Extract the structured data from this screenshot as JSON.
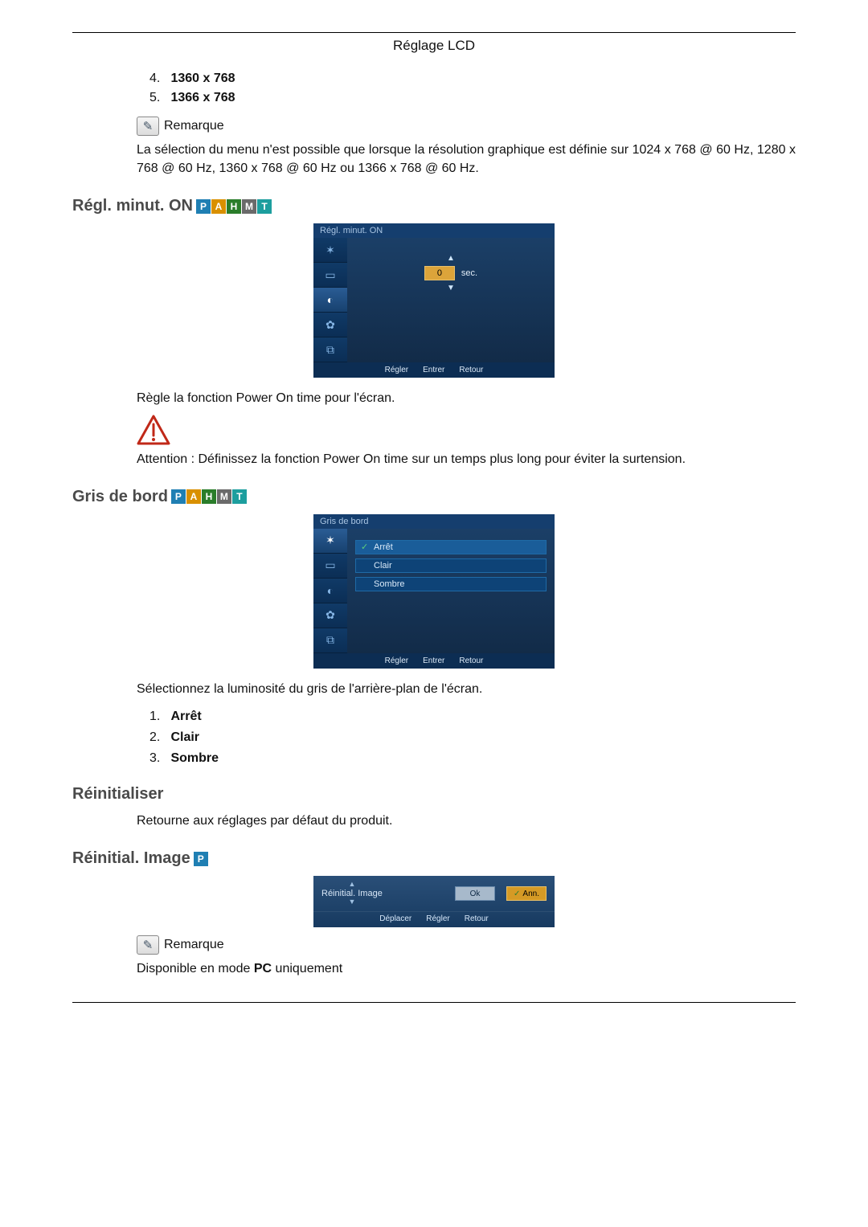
{
  "header": {
    "title": "Réglage LCD"
  },
  "resolutions_cont": [
    {
      "num": "4.",
      "value": "1360 x 768"
    },
    {
      "num": "5.",
      "value": "1366 x 768"
    }
  ],
  "remark": {
    "label": "Remarque",
    "menu_note": "La sélection du menu n'est possible que lorsque la résolution graphique est définie sur 1024 x 768 @ 60 Hz, 1280 x 768 @ 60 Hz, 1360 x 768 @ 60 Hz ou 1366 x 768 @ 60 Hz."
  },
  "power_on": {
    "title": "Régl. minut. ON",
    "osd_title": "Régl. minut. ON",
    "value": "0",
    "unit": "sec.",
    "footer": {
      "a": "Régler",
      "b": "Entrer",
      "c": "Retour"
    },
    "description": "Règle la fonction Power On time pour l'écran.",
    "warning": "Attention : Définissez la fonction Power On time sur un temps plus long pour éviter la surtension."
  },
  "edge_gray": {
    "title": "Gris de bord",
    "osd_title": "Gris de bord",
    "options": [
      {
        "label": "Arrêt",
        "active": true
      },
      {
        "label": "Clair",
        "active": false
      },
      {
        "label": "Sombre",
        "active": false
      }
    ],
    "footer": {
      "a": "Régler",
      "b": "Entrer",
      "c": "Retour"
    },
    "description": "Sélectionnez la luminosité du gris de l'arrière-plan de l'écran.",
    "list": [
      {
        "num": "1.",
        "value": "Arrêt"
      },
      {
        "num": "2.",
        "value": "Clair"
      },
      {
        "num": "3.",
        "value": "Sombre"
      }
    ]
  },
  "reset": {
    "title": "Réinitialiser",
    "description": "Retourne aux réglages par défaut du produit."
  },
  "reset_image": {
    "title": "Réinitial. Image",
    "osd_label": "Réinitial. Image",
    "ok": "Ok",
    "cancel": "Ann.",
    "footer": {
      "a": "Déplacer",
      "b": "Régler",
      "c": "Retour"
    },
    "remark_label": "Remarque",
    "remark_pre": "Disponible en mode ",
    "remark_bold": "PC",
    "remark_post": " uniquement"
  },
  "mode_tags": [
    "P",
    "A",
    "H",
    "M",
    "T"
  ]
}
